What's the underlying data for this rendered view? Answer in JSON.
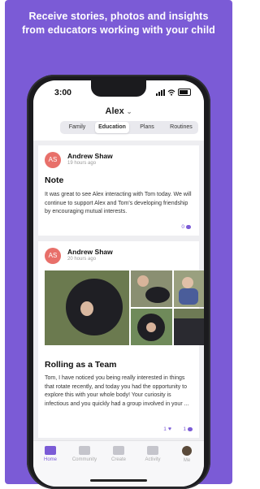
{
  "promo": {
    "headline": "Receive stories, photos and insights\nfrom educators working with your child",
    "background": "#7b5bd6"
  },
  "status_bar": {
    "time": "3:00"
  },
  "header": {
    "child_name": "Alex",
    "tabs": [
      {
        "label": "Family",
        "active": false
      },
      {
        "label": "Education",
        "active": true
      },
      {
        "label": "Plans",
        "active": false
      },
      {
        "label": "Routines",
        "active": false
      }
    ]
  },
  "posts": [
    {
      "initials": "AS",
      "author": "Andrew Shaw",
      "ago": "19 hours ago",
      "title": "Note",
      "body": "It was great to see Alex interacting with Tom today. We will continue to support Alex and Tom's developing friendship by encouraging mutual interests.",
      "comments": "0"
    },
    {
      "initials": "AS",
      "author": "Andrew Shaw",
      "ago": "20 hours ago",
      "title": "Rolling as a Team",
      "body": "Tom, I have noticed you being really interested in things that rotate recently, and today you had the opportunity to explore this with your whole body! Your curiosity is infectious and you quickly had a group involved in your ...",
      "likes": "1",
      "comments": "1"
    }
  ],
  "tabbar": {
    "items": [
      {
        "label": "Home",
        "icon": "book-icon",
        "active": true
      },
      {
        "label": "Community",
        "icon": "chat-icon",
        "active": false
      },
      {
        "label": "Create",
        "icon": "plus-icon",
        "active": false
      },
      {
        "label": "Activity",
        "icon": "list-icon",
        "active": false
      },
      {
        "label": "Me",
        "icon": "avatar-icon",
        "active": false
      }
    ]
  },
  "colors": {
    "accent": "#7b5bd6",
    "avatar": "#e8706a"
  }
}
